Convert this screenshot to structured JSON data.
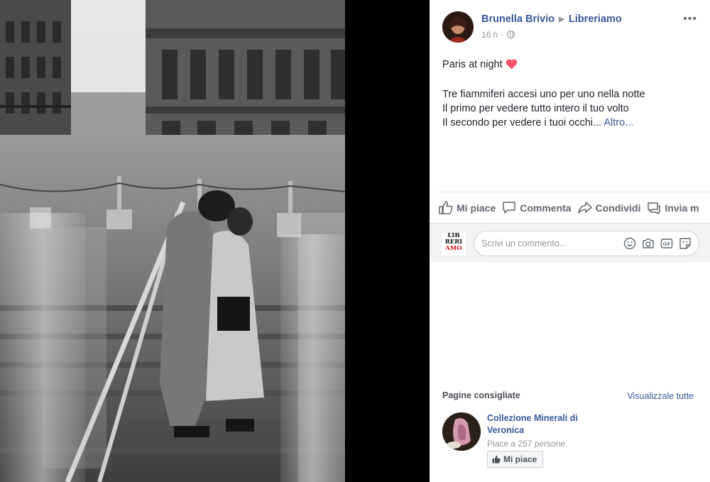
{
  "post": {
    "author": "Brunella Brivio",
    "page": "Libreriamo",
    "time": "16 h",
    "title": "Paris at night",
    "body_lines": [
      "Tre fiammiferi accesi uno per uno nella notte",
      "Il primo per vedere tutto intero il tuo volto",
      "Il secondo per vedere i tuoi occhi..."
    ],
    "more_link": "Altro...",
    "menu_icon": "more-dots-icon"
  },
  "actions": {
    "like": "Mi piace",
    "comment": "Commenta",
    "share": "Condividi",
    "send": "Invia m"
  },
  "comment": {
    "placeholder": "Scrivi un commento...",
    "logo_lines": [
      "LIB",
      "RERI",
      "AMO"
    ]
  },
  "suggestions": {
    "heading": "Pagine consigliate",
    "see_all": "Visualizzale tutte",
    "items": [
      {
        "name": "Collezione Minerali di Veronica",
        "likes": "Piace a 257 persone.",
        "button": "Mi piace"
      }
    ]
  },
  "colors": {
    "link": "#365899",
    "secondary_text": "#90949c",
    "heart": "#f25268",
    "viewer_bg": "#000000"
  }
}
